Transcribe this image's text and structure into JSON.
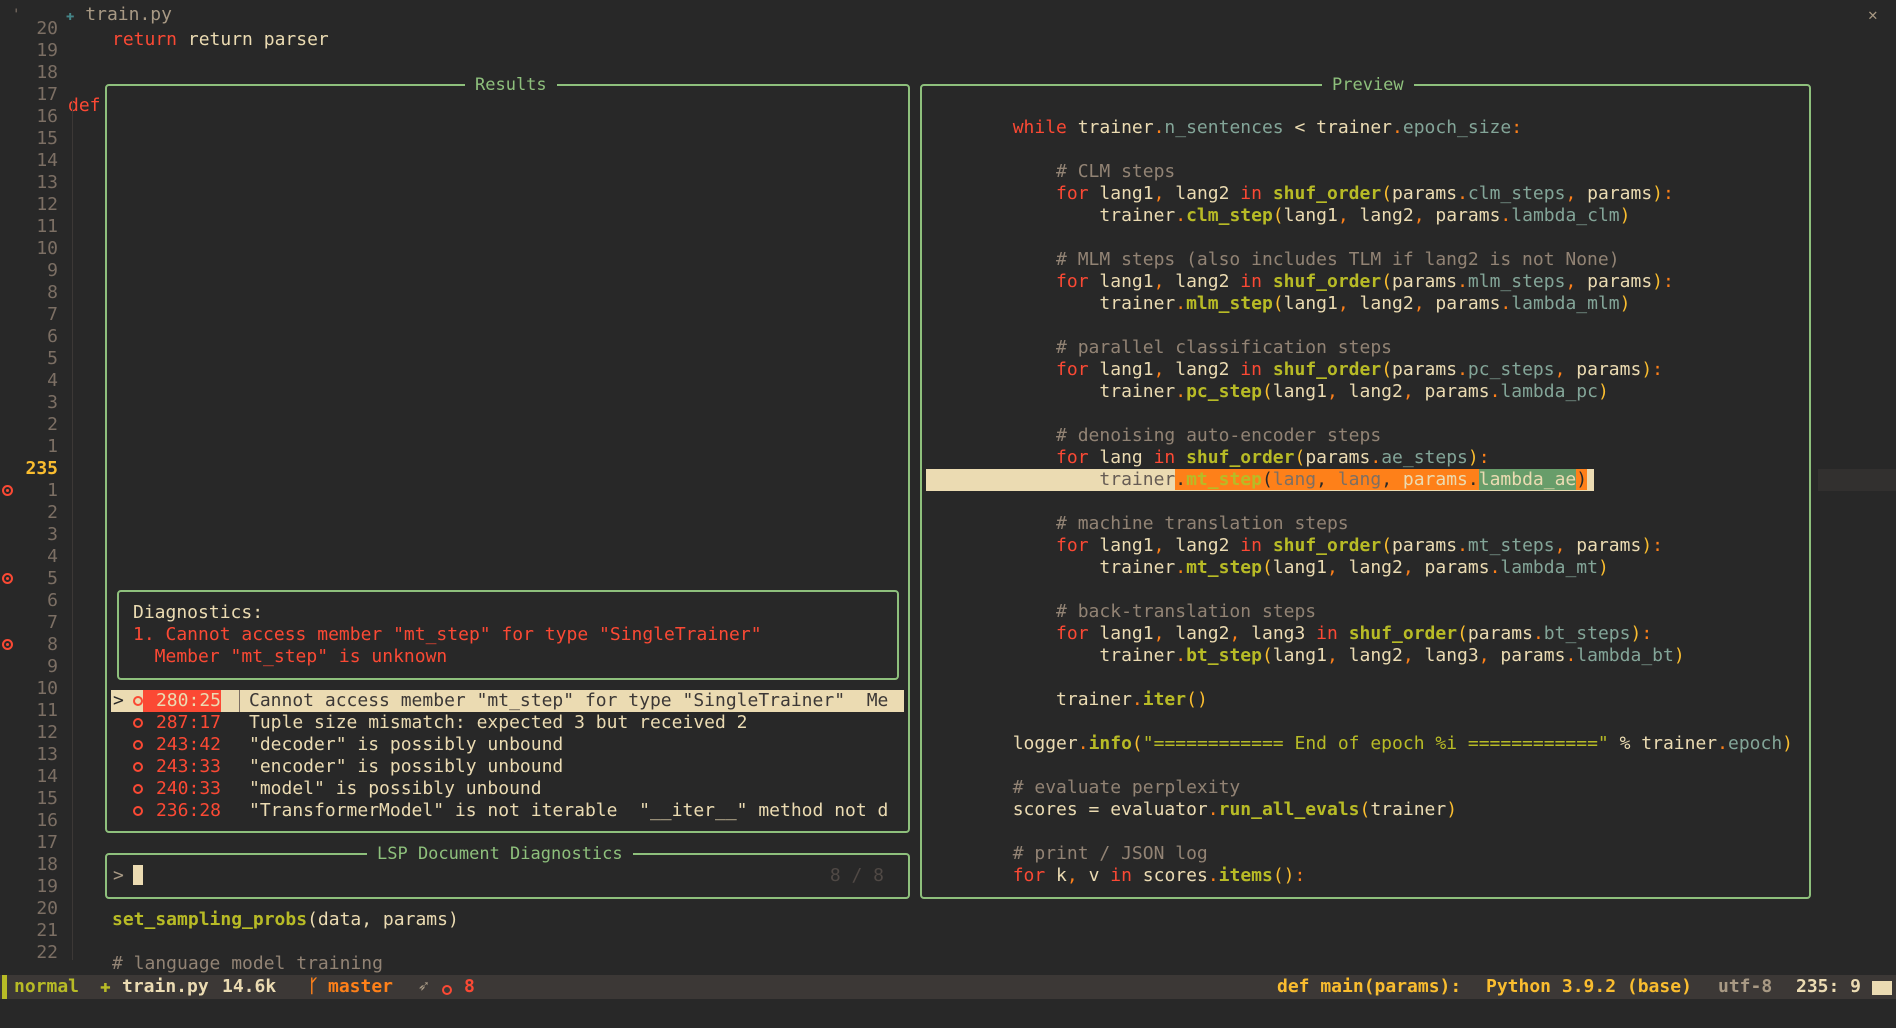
{
  "tab": {
    "filename": "train.py",
    "close": "✕",
    "corner": "'"
  },
  "editor": {
    "line20_text": "return parser",
    "def_kw": "def",
    "bottom_lines": [
      {
        "fn": "set_sampling_probs",
        "rest": "(data, params)"
      },
      {
        "comment": "# language model training"
      }
    ]
  },
  "gutter": [
    {
      "n": "20",
      "err": false
    },
    {
      "n": "19",
      "err": false
    },
    {
      "n": "18",
      "err": false
    },
    {
      "n": "17",
      "err": false
    },
    {
      "n": "16",
      "err": false
    },
    {
      "n": "15",
      "err": false
    },
    {
      "n": "14",
      "err": false
    },
    {
      "n": "13",
      "err": false
    },
    {
      "n": "12",
      "err": false
    },
    {
      "n": "11",
      "err": false
    },
    {
      "n": "10",
      "err": false
    },
    {
      "n": "9",
      "err": false
    },
    {
      "n": "8",
      "err": false
    },
    {
      "n": "7",
      "err": false
    },
    {
      "n": "6",
      "err": false
    },
    {
      "n": "5",
      "err": false
    },
    {
      "n": "4",
      "err": false
    },
    {
      "n": "3",
      "err": false
    },
    {
      "n": "2",
      "err": false
    },
    {
      "n": "1",
      "err": false
    },
    {
      "n": "235",
      "err": false,
      "current": true
    },
    {
      "n": "1",
      "err": true
    },
    {
      "n": "2",
      "err": false
    },
    {
      "n": "3",
      "err": false
    },
    {
      "n": "4",
      "err": false
    },
    {
      "n": "5",
      "err": true
    },
    {
      "n": "6",
      "err": false
    },
    {
      "n": "7",
      "err": false
    },
    {
      "n": "8",
      "err": true
    },
    {
      "n": "9",
      "err": false
    },
    {
      "n": "10",
      "err": false
    },
    {
      "n": "11",
      "err": false
    },
    {
      "n": "12",
      "err": false
    },
    {
      "n": "13",
      "err": false
    },
    {
      "n": "14",
      "err": false
    },
    {
      "n": "15",
      "err": false
    },
    {
      "n": "16",
      "err": false
    },
    {
      "n": "17",
      "err": false
    },
    {
      "n": "18",
      "err": false
    },
    {
      "n": "19",
      "err": false
    },
    {
      "n": "20",
      "err": false
    },
    {
      "n": "21",
      "err": false
    },
    {
      "n": "22",
      "err": false
    }
  ],
  "results": {
    "title": "Results",
    "diagnostics_header": "Diagnostics:",
    "diagnostics_line1": "1. Cannot access member \"mt_step\" for type \"SingleTrainer\"",
    "diagnostics_line2": "  Member \"mt_step\" is unknown",
    "rows": [
      {
        "pointer": ">",
        "pos": "280:25",
        "msg": "Cannot access member \"mt_step\" for type \"SingleTrainer\"  Me",
        "selected": true
      },
      {
        "pointer": " ",
        "pos": "287:17",
        "msg": "Tuple size mismatch: expected 3 but received 2",
        "selected": false
      },
      {
        "pointer": " ",
        "pos": "243:42",
        "msg": "\"decoder\" is possibly unbound",
        "selected": false
      },
      {
        "pointer": " ",
        "pos": "243:33",
        "msg": "\"encoder\" is possibly unbound",
        "selected": false
      },
      {
        "pointer": " ",
        "pos": "240:33",
        "msg": "\"model\" is possibly unbound",
        "selected": false
      },
      {
        "pointer": " ",
        "pos": "236:28",
        "msg": "\"TransformerModel\" is not iterable  \"__iter__\" method not d",
        "selected": false
      }
    ]
  },
  "prompt": {
    "title": "LSP Document Diagnostics",
    "prefix": ">",
    "input_value": "",
    "count": "8 / 8"
  },
  "preview": {
    "title": "Preview",
    "lines": [
      [
        [
          "kw",
          "        while "
        ],
        [
          "",
          "trainer"
        ],
        [
          "op",
          "."
        ],
        [
          "attr",
          "n_sentences"
        ],
        [
          "",
          " < trainer"
        ],
        [
          "op",
          "."
        ],
        [
          "attr",
          "epoch_size"
        ],
        [
          "op",
          ":"
        ]
      ],
      [],
      [
        [
          "com",
          "            # CLM steps"
        ]
      ],
      [
        [
          "kw",
          "            for "
        ],
        [
          "",
          "lang1"
        ],
        [
          "op",
          ", "
        ],
        [
          "",
          "lang2 "
        ],
        [
          "kw",
          "in "
        ],
        [
          "fn",
          "shuf_order"
        ],
        [
          "yel",
          "("
        ],
        [
          "",
          "params"
        ],
        [
          "op",
          "."
        ],
        [
          "attr",
          "clm_steps"
        ],
        [
          "op",
          ", "
        ],
        [
          "",
          "params"
        ],
        [
          "yel",
          ")"
        ],
        [
          "op",
          ":"
        ]
      ],
      [
        [
          "",
          "                trainer"
        ],
        [
          "op",
          "."
        ],
        [
          "fn",
          "clm_step"
        ],
        [
          "yel",
          "("
        ],
        [
          "",
          "lang1"
        ],
        [
          "op",
          ", "
        ],
        [
          "",
          "lang2"
        ],
        [
          "op",
          ", "
        ],
        [
          "",
          "params"
        ],
        [
          "op",
          "."
        ],
        [
          "attr",
          "lambda_clm"
        ],
        [
          "yel",
          ")"
        ]
      ],
      [],
      [
        [
          "com",
          "            # MLM steps (also includes TLM if lang2 is not None)"
        ]
      ],
      [
        [
          "kw",
          "            for "
        ],
        [
          "",
          "lang1"
        ],
        [
          "op",
          ", "
        ],
        [
          "",
          "lang2 "
        ],
        [
          "kw",
          "in "
        ],
        [
          "fn",
          "shuf_order"
        ],
        [
          "yel",
          "("
        ],
        [
          "",
          "params"
        ],
        [
          "op",
          "."
        ],
        [
          "attr",
          "mlm_steps"
        ],
        [
          "op",
          ", "
        ],
        [
          "",
          "params"
        ],
        [
          "yel",
          ")"
        ],
        [
          "op",
          ":"
        ]
      ],
      [
        [
          "",
          "                trainer"
        ],
        [
          "op",
          "."
        ],
        [
          "fn",
          "mlm_step"
        ],
        [
          "yel",
          "("
        ],
        [
          "",
          "lang1"
        ],
        [
          "op",
          ", "
        ],
        [
          "",
          "lang2"
        ],
        [
          "op",
          ", "
        ],
        [
          "",
          "params"
        ],
        [
          "op",
          "."
        ],
        [
          "attr",
          "lambda_mlm"
        ],
        [
          "yel",
          ")"
        ]
      ],
      [],
      [
        [
          "com",
          "            # parallel classification steps"
        ]
      ],
      [
        [
          "kw",
          "            for "
        ],
        [
          "",
          "lang1"
        ],
        [
          "op",
          ", "
        ],
        [
          "",
          "lang2 "
        ],
        [
          "kw",
          "in "
        ],
        [
          "fn",
          "shuf_order"
        ],
        [
          "yel",
          "("
        ],
        [
          "",
          "params"
        ],
        [
          "op",
          "."
        ],
        [
          "attr",
          "pc_steps"
        ],
        [
          "op",
          ", "
        ],
        [
          "",
          "params"
        ],
        [
          "yel",
          ")"
        ],
        [
          "op",
          ":"
        ]
      ],
      [
        [
          "",
          "                trainer"
        ],
        [
          "op",
          "."
        ],
        [
          "fn",
          "pc_step"
        ],
        [
          "yel",
          "("
        ],
        [
          "",
          "lang1"
        ],
        [
          "op",
          ", "
        ],
        [
          "",
          "lang2"
        ],
        [
          "op",
          ", "
        ],
        [
          "",
          "params"
        ],
        [
          "op",
          "."
        ],
        [
          "attr",
          "lambda_pc"
        ],
        [
          "yel",
          ")"
        ]
      ],
      [],
      [
        [
          "com",
          "            # denoising auto-encoder steps"
        ]
      ],
      [
        [
          "kw",
          "            for "
        ],
        [
          "",
          "lang "
        ],
        [
          "kw",
          "in "
        ],
        [
          "fn",
          "shuf_order"
        ],
        [
          "yel",
          "("
        ],
        [
          "",
          "params"
        ],
        [
          "op",
          "."
        ],
        [
          "attr",
          "ae_steps"
        ],
        [
          "yel",
          ")"
        ],
        [
          "op",
          ":"
        ]
      ],
      "HIGHLIGHT",
      [],
      [
        [
          "com",
          "            # machine translation steps"
        ]
      ],
      [
        [
          "kw",
          "            for "
        ],
        [
          "",
          "lang1"
        ],
        [
          "op",
          ", "
        ],
        [
          "",
          "lang2 "
        ],
        [
          "kw",
          "in "
        ],
        [
          "fn",
          "shuf_order"
        ],
        [
          "yel",
          "("
        ],
        [
          "",
          "params"
        ],
        [
          "op",
          "."
        ],
        [
          "attr",
          "mt_steps"
        ],
        [
          "op",
          ", "
        ],
        [
          "",
          "params"
        ],
        [
          "yel",
          ")"
        ],
        [
          "op",
          ":"
        ]
      ],
      [
        [
          "",
          "                trainer"
        ],
        [
          "op",
          "."
        ],
        [
          "fn",
          "mt_step"
        ],
        [
          "yel",
          "("
        ],
        [
          "",
          "lang1"
        ],
        [
          "op",
          ", "
        ],
        [
          "",
          "lang2"
        ],
        [
          "op",
          ", "
        ],
        [
          "",
          "params"
        ],
        [
          "op",
          "."
        ],
        [
          "attr",
          "lambda_mt"
        ],
        [
          "yel",
          ")"
        ]
      ],
      [],
      [
        [
          "com",
          "            # back-translation steps"
        ]
      ],
      [
        [
          "kw",
          "            for "
        ],
        [
          "",
          "lang1"
        ],
        [
          "op",
          ", "
        ],
        [
          "",
          "lang2"
        ],
        [
          "op",
          ", "
        ],
        [
          "",
          "lang3 "
        ],
        [
          "kw",
          "in "
        ],
        [
          "fn",
          "shuf_order"
        ],
        [
          "yel",
          "("
        ],
        [
          "",
          "params"
        ],
        [
          "op",
          "."
        ],
        [
          "attr",
          "bt_steps"
        ],
        [
          "yel",
          ")"
        ],
        [
          "op",
          ":"
        ]
      ],
      [
        [
          "",
          "                trainer"
        ],
        [
          "op",
          "."
        ],
        [
          "fn",
          "bt_step"
        ],
        [
          "yel",
          "("
        ],
        [
          "",
          "lang1"
        ],
        [
          "op",
          ", "
        ],
        [
          "",
          "lang2"
        ],
        [
          "op",
          ", "
        ],
        [
          "",
          "lang3"
        ],
        [
          "op",
          ", "
        ],
        [
          "",
          "params"
        ],
        [
          "op",
          "."
        ],
        [
          "attr",
          "lambda_bt"
        ],
        [
          "yel",
          ")"
        ]
      ],
      [],
      [
        [
          "",
          "            trainer"
        ],
        [
          "op",
          "."
        ],
        [
          "fn",
          "iter"
        ],
        [
          "yel",
          "()"
        ]
      ],
      [],
      [
        [
          "",
          "        logger"
        ],
        [
          "op",
          "."
        ],
        [
          "fn",
          "info"
        ],
        [
          "yel",
          "("
        ],
        [
          "str",
          "\"============ End of epoch %i ============\""
        ],
        [
          "",
          " % trainer"
        ],
        [
          "op",
          "."
        ],
        [
          "attr",
          "epoch"
        ],
        [
          "yel",
          ")"
        ]
      ],
      [],
      [
        [
          "com",
          "        # evaluate perplexity"
        ]
      ],
      [
        [
          "",
          "        scores = evaluator"
        ],
        [
          "op",
          "."
        ],
        [
          "fn",
          "run_all_evals"
        ],
        [
          "yel",
          "("
        ],
        [
          "",
          "trainer"
        ],
        [
          "yel",
          ")"
        ]
      ],
      [],
      [
        [
          "com",
          "        # print / JSON log"
        ]
      ],
      [
        [
          "kw",
          "        for "
        ],
        [
          "",
          "k"
        ],
        [
          "op",
          ", "
        ],
        [
          "",
          "v "
        ],
        [
          "kw",
          "in "
        ],
        [
          "",
          "scores"
        ],
        [
          "op",
          "."
        ],
        [
          "fn",
          "items"
        ],
        [
          "yel",
          "()"
        ],
        [
          "op",
          ":"
        ]
      ]
    ],
    "highlight": {
      "prefix": "                trainer",
      "dot": ".",
      "method": "mt_step",
      "open": "(",
      "a1": "lang",
      "sep": ",",
      "a2": " lang",
      "a3": " params",
      "dot2": ".",
      "attr": "lambda_ae",
      "close": ")"
    }
  },
  "status": {
    "mode": "normal",
    "file": "train.py",
    "size": "14.6k",
    "branch": "master",
    "errors": "8",
    "context": "def main(params):",
    "lang": "Python 3.9.2 (base)",
    "encoding": "utf-8",
    "position": "235: 9"
  }
}
